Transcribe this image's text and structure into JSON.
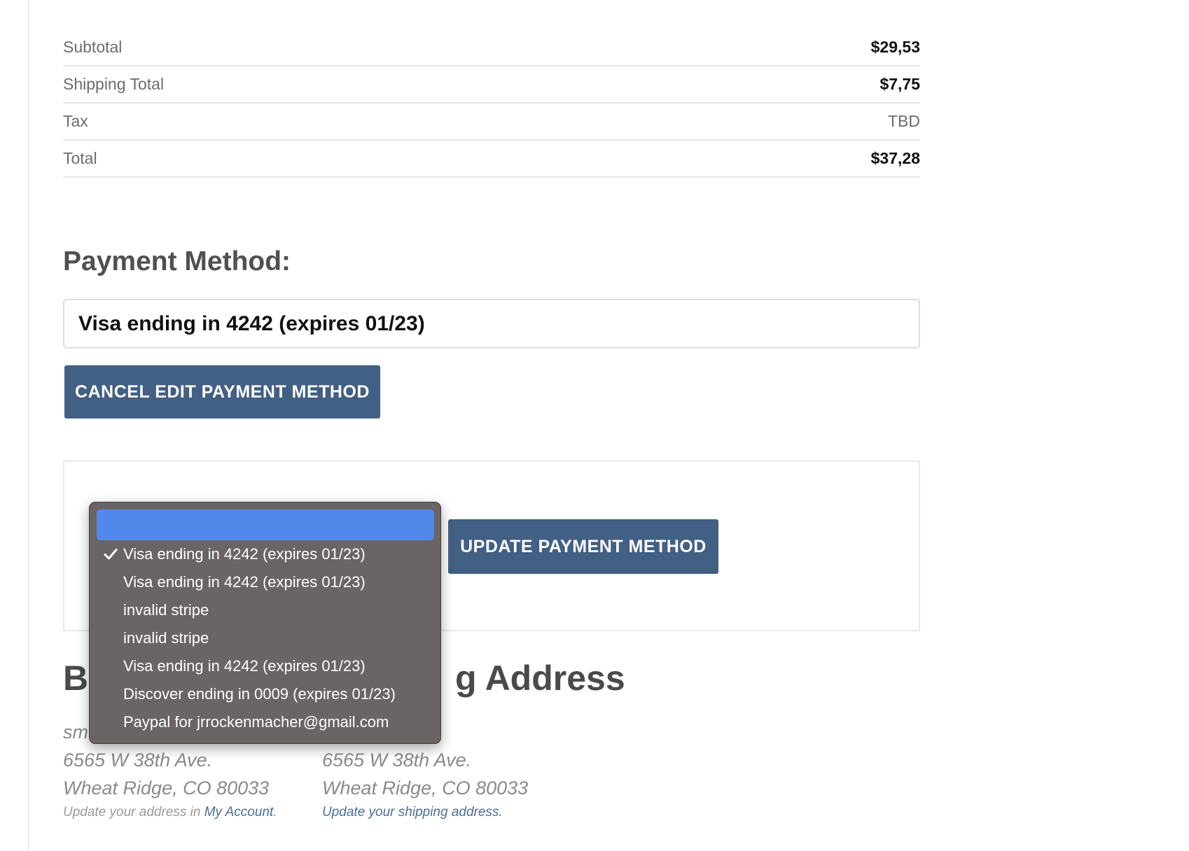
{
  "totals": [
    {
      "label": "Subtotal",
      "value": "$29,53"
    },
    {
      "label": "Shipping Total",
      "value": "$7,75"
    },
    {
      "label": "Tax",
      "value": "TBD"
    },
    {
      "label": "Total",
      "value": "$37,28"
    }
  ],
  "payment": {
    "title": "Payment Method:",
    "current": "Visa ending in 4242 (expires 01/23)",
    "cancel_button": "CANCEL EDIT PAYMENT METHOD",
    "update_button": "UPDATE PAYMENT METHOD"
  },
  "dropdown": {
    "options": [
      {
        "label": "Visa ending in 4242 (expires 01/23)",
        "selected": true
      },
      {
        "label": "Visa ending in 4242 (expires 01/23)",
        "selected": false
      },
      {
        "label": "invalid stripe",
        "selected": false
      },
      {
        "label": "invalid stripe",
        "selected": false
      },
      {
        "label": "Visa ending in 4242 (expires 01/23)",
        "selected": false
      },
      {
        "label": "Discover ending in 0009 (expires 01/23)",
        "selected": false
      },
      {
        "label": "Paypal for jrrockenmacher@gmail.com",
        "selected": false
      }
    ],
    "highlight_color": "#5288ea",
    "check_icon": "checkmark-icon"
  },
  "addresses": {
    "heading_left": "Bi",
    "heading_right": "g Address",
    "billing": {
      "name_partial": "sm",
      "street": "6565 W 38th Ave.",
      "city": "Wheat Ridge, CO 80033",
      "note_prefix": "Update your address in ",
      "note_link": "My Account",
      "note_suffix": "."
    },
    "shipping": {
      "street": "6565 W 38th Ave.",
      "city": "Wheat Ridge, CO 80033",
      "note": "Update your shipping address."
    }
  },
  "colors": {
    "button": "#425f84",
    "link": "#4a6d96"
  }
}
